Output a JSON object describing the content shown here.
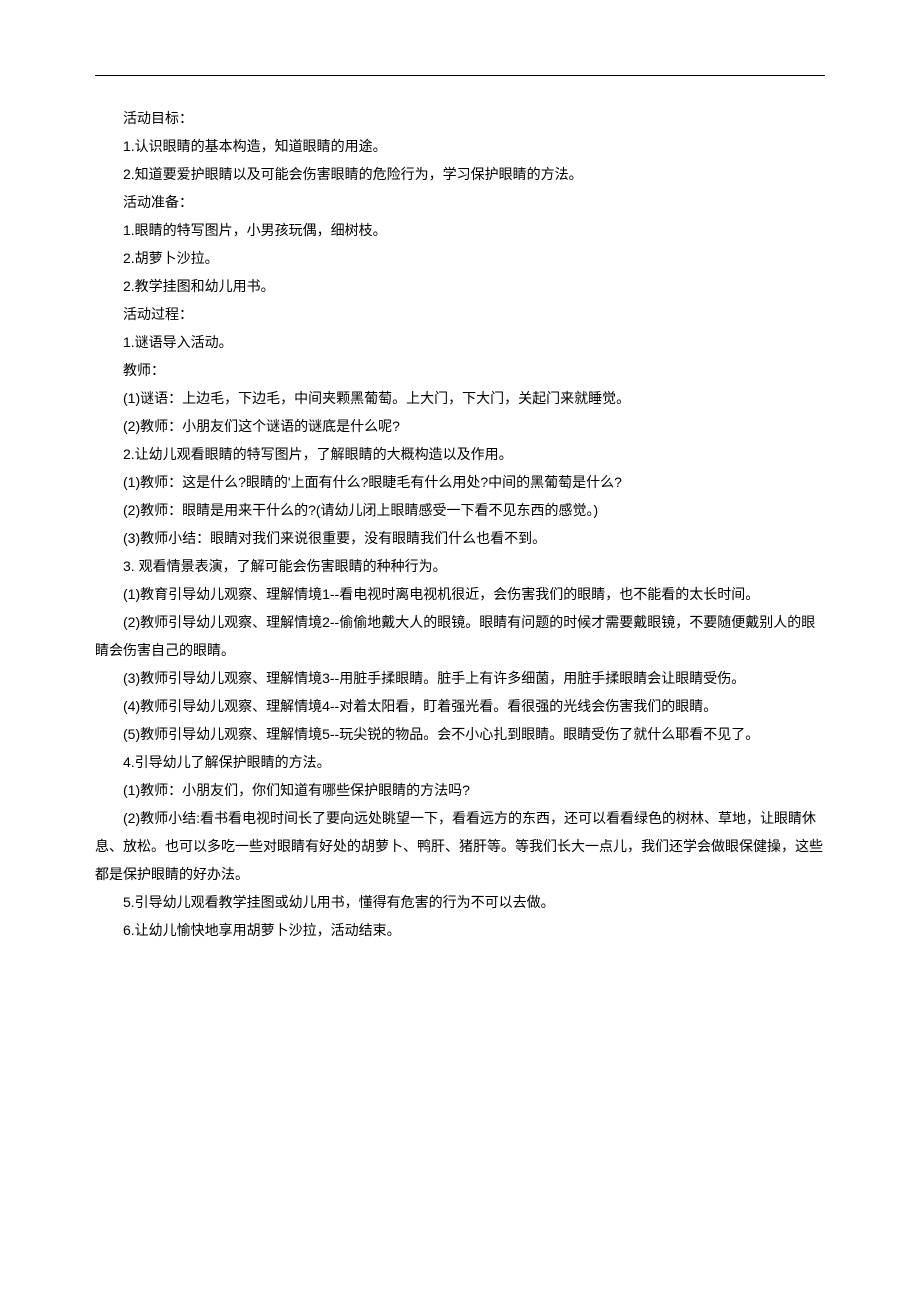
{
  "lines": [
    "活动目标：",
    "1.认识眼睛的基本构造，知道眼睛的用途。",
    "2.知道要爱护眼睛以及可能会伤害眼睛的危险行为，学习保护眼睛的方法。",
    "活动准备：",
    "1.眼睛的特写图片，小男孩玩偶，细树枝。",
    "2.胡萝卜沙拉。",
    "2.教学挂图和幼儿用书。",
    "活动过程：",
    "1.谜语导入活动。",
    "教师：",
    "(1)谜语：上边毛，下边毛，中间夹颗黑葡萄。上大门，下大门，关起门来就睡觉。",
    "(2)教师：小朋友们这个谜语的谜底是什么呢?",
    "2.让幼儿观看眼睛的特写图片，了解眼睛的大概构造以及作用。",
    "(1)教师：这是什么?眼睛的'上面有什么?眼睫毛有什么用处?中间的黑葡萄是什么?",
    "(2)教师：眼睛是用来干什么的?(请幼儿闭上眼睛感受一下看不见东西的感觉。)",
    "(3)教师小结：眼睛对我们来说很重要，没有眼睛我们什么也看不到。",
    "3.  观看情景表演，了解可能会伤害眼睛的种种行为。",
    "(1)教育引导幼儿观察、理解情境1--看电视时离电视机很近，会伤害我们的眼睛，也不能看的太长时间。"
  ],
  "wrap1_a": "(2)教师引导幼儿观察、理解情境2--偷偷地戴大人的眼镜。眼睛有问题的时候才需要戴眼镜，不要随便戴别人的眼",
  "wrap1_b": "睛会伤害自己的眼睛。",
  "lines2": [
    "(3)教师引导幼儿观察、理解情境3--用脏手揉眼睛。脏手上有许多细菌，用脏手揉眼睛会让眼睛受伤。",
    "(4)教师引导幼儿观察、理解情境4--对着太阳看，盯着强光看。看很强的光线会伤害我们的眼睛。",
    "(5)教师引导幼儿观察、理解情境5--玩尖锐的物品。会不小心扎到眼睛。眼睛受伤了就什么耶看不见了。",
    "4.引导幼儿了解保护眼睛的方法。",
    "(1)教师：小朋友们，你们知道有哪些保护眼睛的方法吗?"
  ],
  "wrap2_a": "(2)教师小结:看书看电视时间长了要向远处眺望一下，看看远方的东西，还可以看看绿色的树林、草地，让眼睛休",
  "wrap2_b": "息、放松。也可以多吃一些对眼睛有好处的胡萝卜、鸭肝、猪肝等。等我们长大一点儿，我们还学会做眼保健操，这些",
  "wrap2_c": "都是保护眼睛的好办法。",
  "lines3": [
    "5.引导幼儿观看教学挂图或幼儿用书，懂得有危害的行为不可以去做。",
    "6.让幼儿愉快地享用胡萝卜沙拉，活动结束。"
  ]
}
